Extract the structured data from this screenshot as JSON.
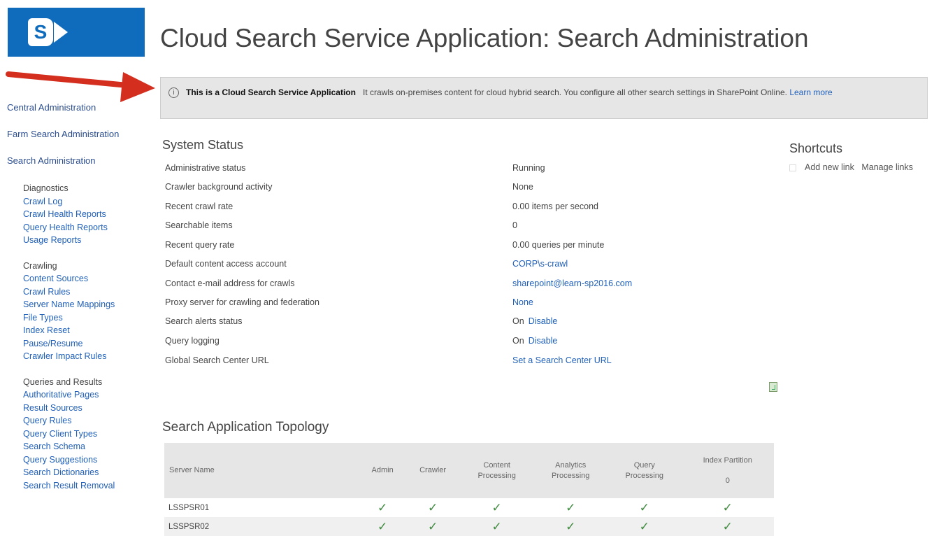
{
  "logo": {
    "letter": "S"
  },
  "page_title": "Cloud Search Service Application: Search Administration",
  "left_nav": {
    "top_links": [
      "Central Administration",
      "Farm Search Administration",
      "Search Administration"
    ],
    "groups": [
      {
        "title": "Diagnostics",
        "items": [
          "Crawl Log",
          "Crawl Health Reports",
          "Query Health Reports",
          "Usage Reports"
        ]
      },
      {
        "title": "Crawling",
        "items": [
          "Content Sources",
          "Crawl Rules",
          "Server Name Mappings",
          "File Types",
          "Index Reset",
          "Pause/Resume",
          "Crawler Impact Rules"
        ]
      },
      {
        "title": "Queries and Results",
        "items": [
          "Authoritative Pages",
          "Result Sources",
          "Query Rules",
          "Query Client Types",
          "Search Schema",
          "Query Suggestions",
          "Search Dictionaries",
          "Search Result Removal"
        ]
      }
    ]
  },
  "banner": {
    "icon": "info-icon",
    "bold_text": "This is a Cloud Search Service Application",
    "text": "It crawls on-premises content for cloud hybrid search. You configure all other search settings in SharePoint Online.",
    "link": "Learn more"
  },
  "system_status": {
    "title": "System Status",
    "rows": [
      {
        "label": "Administrative status",
        "value": "Running"
      },
      {
        "label": "Crawler background activity",
        "value": "None"
      },
      {
        "label": "Recent crawl rate",
        "value": "0.00 items per second"
      },
      {
        "label": "Searchable items",
        "value": "0"
      },
      {
        "label": "Recent query rate",
        "value": "0.00 queries per minute"
      },
      {
        "label": "Default content access account",
        "link": "CORP\\s-crawl"
      },
      {
        "label": "Contact e-mail address for crawls",
        "link": "sharepoint@learn-sp2016.com"
      },
      {
        "label": "Proxy server for crawling and federation",
        "link": "None"
      },
      {
        "label": "Search alerts status",
        "value": "On",
        "link": "Disable"
      },
      {
        "label": "Query logging",
        "value": "On",
        "link": "Disable"
      },
      {
        "label": "Global Search Center URL",
        "link": "Set a Search Center URL"
      }
    ]
  },
  "shortcuts": {
    "title": "Shortcuts",
    "add_link": "Add new link",
    "manage_link": "Manage links"
  },
  "topology": {
    "title": "Search Application Topology",
    "columns": {
      "server": "Server Name",
      "admin": "Admin",
      "crawler": "Crawler",
      "content_1": "Content",
      "content_2": "Processing",
      "analytics_1": "Analytics",
      "analytics_2": "Processing",
      "query_1": "Query",
      "query_2": "Processing",
      "index": "Index Partition",
      "index_num": "0"
    },
    "check": "✓",
    "rows": [
      {
        "server": "LSSPSR01"
      },
      {
        "server": "LSSPSR02"
      }
    ]
  }
}
